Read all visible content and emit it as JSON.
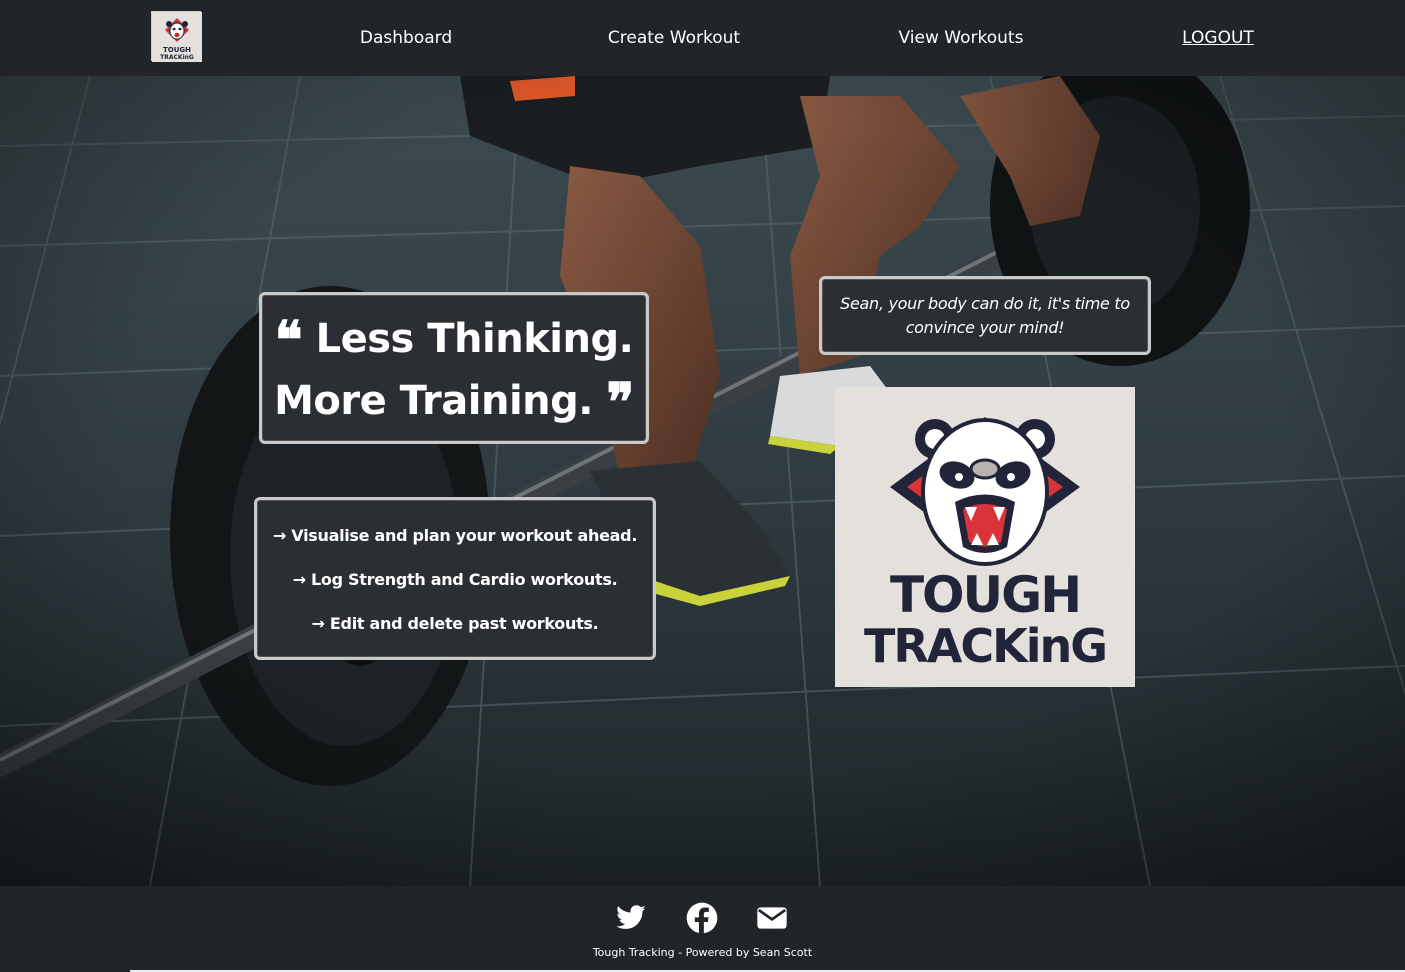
{
  "nav": {
    "logo_alt": "Tough Tracking logo",
    "links": [
      "Dashboard",
      "Create Workout",
      "View Workouts",
      "LOGOUT"
    ]
  },
  "hero": {
    "quote_line1": "Less Thinking.",
    "quote_line2": "More Training.",
    "open_quote": "❝",
    "close_quote": "❞",
    "features": [
      "→ Visualise and plan your workout ahead.",
      "→ Log Strength and Cardio workouts.",
      "→ Edit and delete past workouts."
    ],
    "motivation": "Sean, your body can do it, it's time to convince your mind!",
    "logo_text_line1": "TOUGH",
    "logo_text_line2": "TRACKinG"
  },
  "footer": {
    "icons": [
      "twitter-icon",
      "facebook-icon",
      "envelope-icon"
    ],
    "credit": "Tough Tracking - Powered by Sean Scott"
  },
  "colors": {
    "navbar_bg": "#212529",
    "box_bg": "#2b2f33",
    "box_border": "#c9c9c9",
    "logo_bg": "#e4e0db",
    "logo_red": "#d8343a",
    "logo_navy": "#22253a"
  }
}
